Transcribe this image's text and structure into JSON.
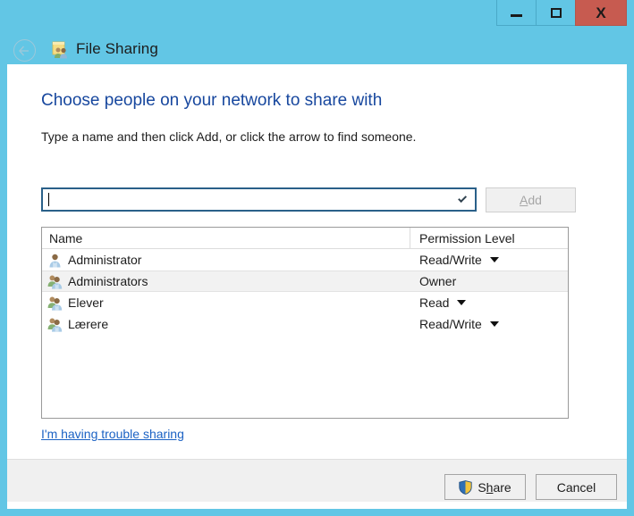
{
  "window": {
    "title": "File Sharing",
    "title_icon": "shared-folder-icon",
    "accent_color": "#62c6e5",
    "close_color": "#c75b50",
    "caption": {
      "minimize_label": "–",
      "maximize_label": "□",
      "close_label": "X"
    },
    "back_button_icon": "back-arrow-icon"
  },
  "content": {
    "heading": "Choose people on your network to share with",
    "heading_color": "#17479e",
    "subheading": "Type a name and then click Add, or click the arrow to find someone.",
    "name_input": {
      "value": "",
      "placeholder": "",
      "dropdown_icon": "chevron-down-icon"
    },
    "add_button": {
      "label": "Add",
      "accesskey": "A",
      "enabled": false
    },
    "trouble_link": "I'm having trouble sharing",
    "trouble_link_color": "#1b62c4"
  },
  "table": {
    "columns": [
      "Name",
      "Permission Level"
    ],
    "rows": [
      {
        "name": "Administrator",
        "icon": "user-icon",
        "permission": "Read/Write",
        "has_dropdown": true,
        "selected": false
      },
      {
        "name": "Administrators",
        "icon": "user-group-icon",
        "permission": "Owner",
        "has_dropdown": false,
        "selected": true
      },
      {
        "name": "Elever",
        "icon": "user-group-icon",
        "permission": "Read",
        "has_dropdown": true,
        "selected": false
      },
      {
        "name": "Lærere",
        "icon": "user-group-icon",
        "permission": "Read/Write",
        "has_dropdown": true,
        "selected": false
      }
    ]
  },
  "footer": {
    "share_button": {
      "label_before": "S",
      "accesskey": "h",
      "label_after": "are",
      "icon": "uac-shield-icon"
    },
    "cancel_button": {
      "label": "Cancel"
    }
  }
}
